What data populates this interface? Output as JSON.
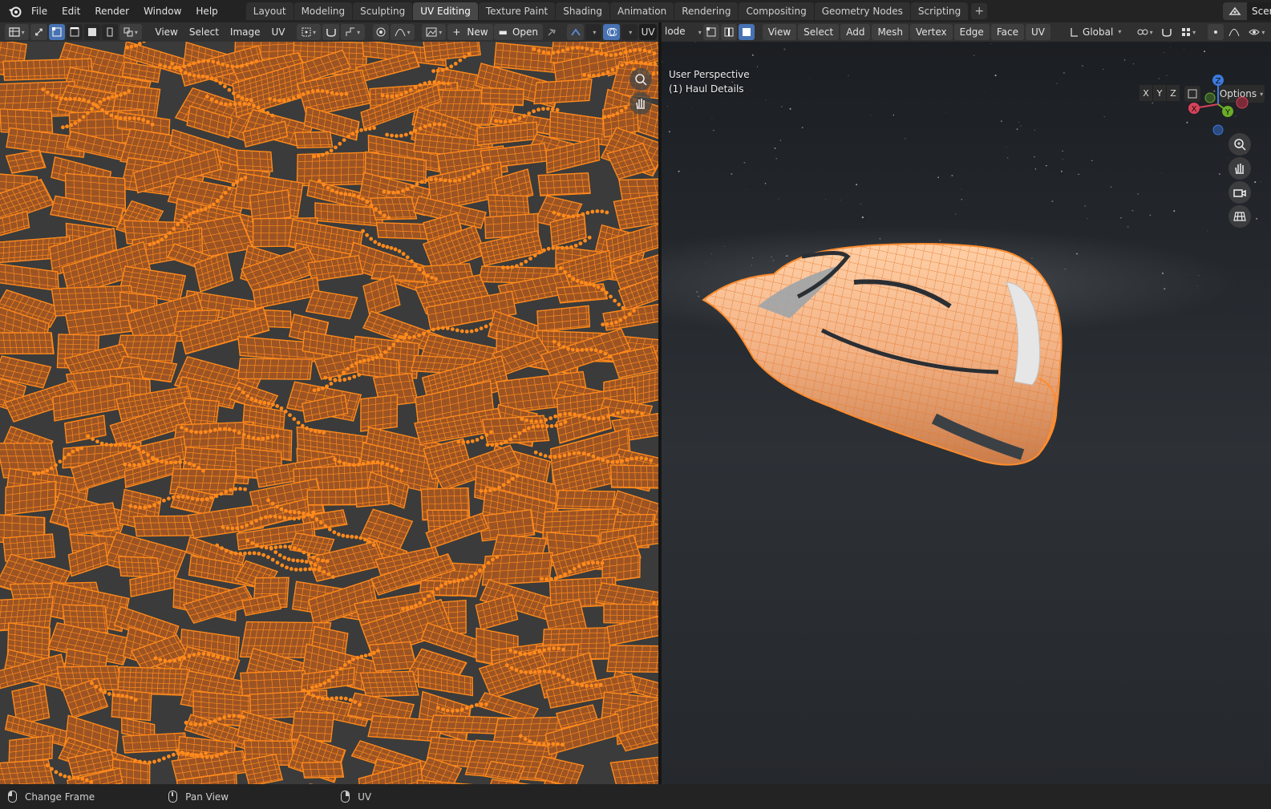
{
  "menu": [
    "File",
    "Edit",
    "Render",
    "Window",
    "Help"
  ],
  "workspaces": [
    {
      "label": "Layout",
      "active": false
    },
    {
      "label": "Modeling",
      "active": false
    },
    {
      "label": "Sculpting",
      "active": false
    },
    {
      "label": "UV Editing",
      "active": true
    },
    {
      "label": "Texture Paint",
      "active": false
    },
    {
      "label": "Shading",
      "active": false
    },
    {
      "label": "Animation",
      "active": false
    },
    {
      "label": "Rendering",
      "active": false
    },
    {
      "label": "Compositing",
      "active": false
    },
    {
      "label": "Geometry Nodes",
      "active": false
    },
    {
      "label": "Scripting",
      "active": false
    }
  ],
  "scene_label": "Scer",
  "uv_header": {
    "view": "View",
    "select": "Select",
    "image": "Image",
    "uv": "UV",
    "new": "New",
    "open": "Open",
    "uv_cut": "UV"
  },
  "viewport_header": {
    "mode": "lode",
    "view": "View",
    "select": "Select",
    "add": "Add",
    "mesh": "Mesh",
    "vertex": "Vertex",
    "edge": "Edge",
    "face": "Face",
    "uv": "UV",
    "orientation": "Global",
    "options": "Options",
    "axis_x": "X",
    "axis_y": "Y",
    "axis_z": "Z"
  },
  "viewport": {
    "perspective": "User Perspective",
    "object": "(1) Haul Details"
  },
  "gizmo": {
    "x": "X",
    "y": "Y",
    "z": "Z"
  },
  "status": [
    {
      "mouse": "left",
      "label": "Change Frame"
    },
    {
      "mouse": "middle",
      "label": "Pan View"
    },
    {
      "mouse": "right",
      "label": "UV"
    }
  ],
  "colors": {
    "accent": "#4772b3",
    "uv_fill": "#9c5424",
    "uv_edge": "#ff8a1c",
    "uv_bg": "#3b3b3b",
    "mesh_orange": "#f08a3a"
  }
}
